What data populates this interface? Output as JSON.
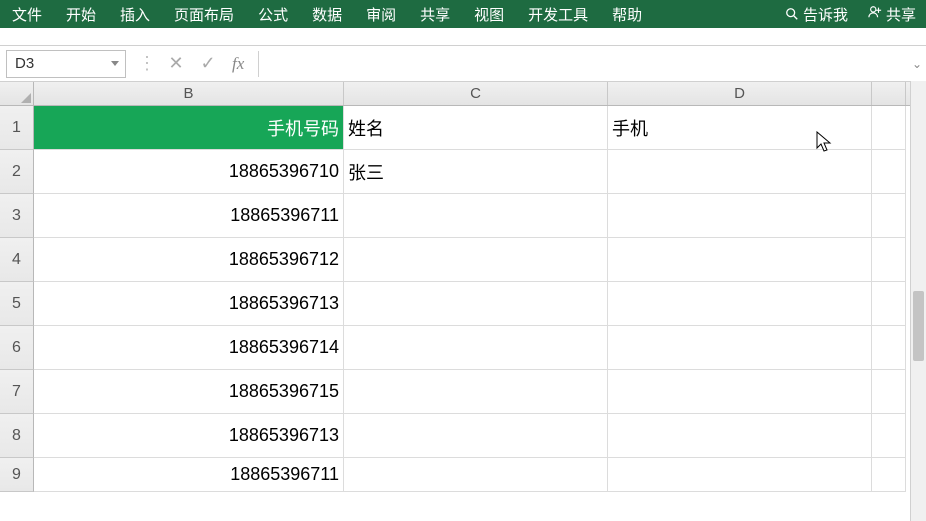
{
  "ribbon": {
    "tabs": [
      "文件",
      "开始",
      "插入",
      "页面布局",
      "公式",
      "数据",
      "审阅",
      "共享",
      "视图",
      "开发工具",
      "帮助"
    ],
    "tellme": "告诉我",
    "share": "共享"
  },
  "namebox": {
    "value": "D3"
  },
  "fx_label": "fx",
  "formula": {
    "value": ""
  },
  "columns": [
    "B",
    "C",
    "D"
  ],
  "row_numbers": [
    "1",
    "2",
    "3",
    "4",
    "5",
    "6",
    "7",
    "8",
    "9"
  ],
  "cells": {
    "r1": {
      "B": "手机号码",
      "C": "姓名",
      "D": "手机"
    },
    "r2": {
      "B": "18865396710",
      "C": "张三",
      "D": ""
    },
    "r3": {
      "B": "18865396711",
      "C": "",
      "D": ""
    },
    "r4": {
      "B": "18865396712",
      "C": "",
      "D": ""
    },
    "r5": {
      "B": "18865396713",
      "C": "",
      "D": ""
    },
    "r6": {
      "B": "18865396714",
      "C": "",
      "D": ""
    },
    "r7": {
      "B": "18865396715",
      "C": "",
      "D": ""
    },
    "r8": {
      "B": "18865396713",
      "C": "",
      "D": ""
    },
    "r9": {
      "B": "18865396711",
      "C": "",
      "D": ""
    }
  }
}
